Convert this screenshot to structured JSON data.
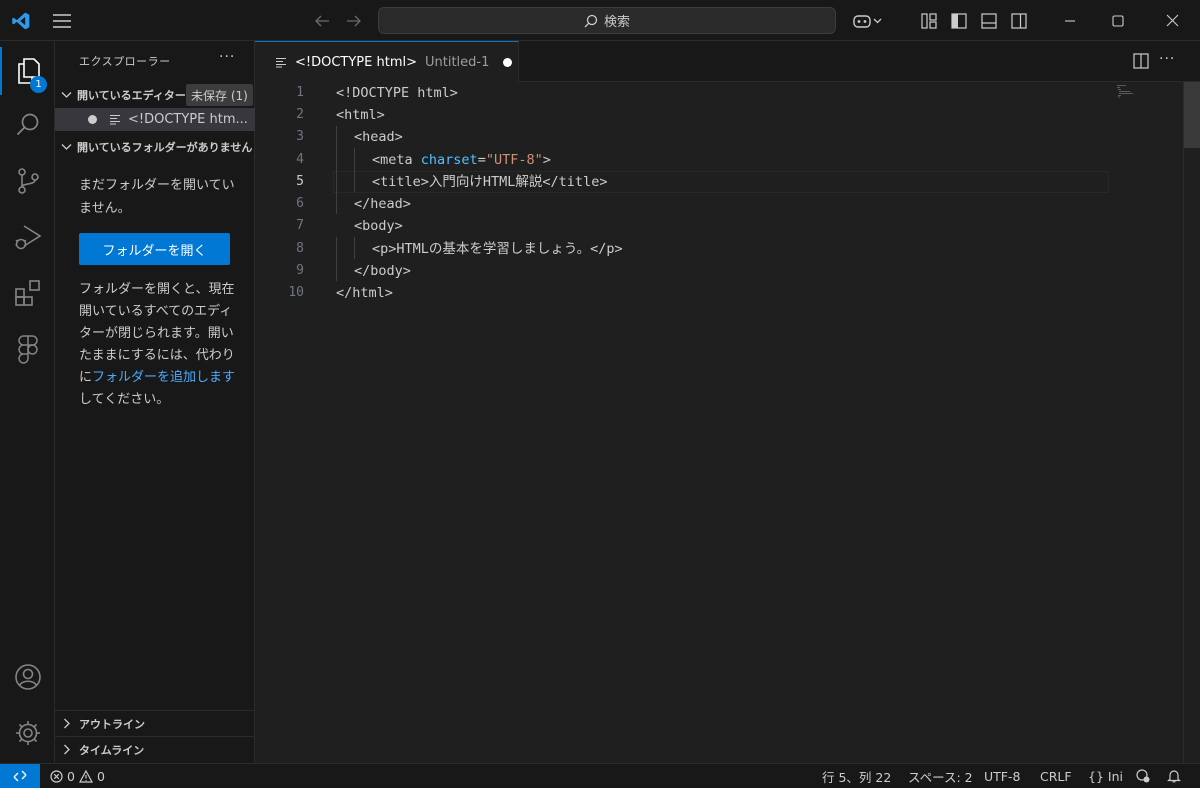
{
  "titlebar": {
    "search_label": "検索"
  },
  "activitybar": {
    "explorer_badge": "1"
  },
  "sidebar": {
    "title": "エクスプローラー",
    "more": "···",
    "open_editors_header": "開いているエディター",
    "unsaved_badge": "未保存 (1)",
    "open_editor_item": "<!DOCTYPE htm...",
    "no_folder_header": "開いているフォルダーがありません",
    "no_folder_text": "まだフォルダーを開いていません。",
    "open_folder_button": "フォルダーを開く",
    "help_text_before": "フォルダーを開くと、現在開いているすべてのエディターが閉じられます。開いたままにするには、代わりに",
    "add_folder_link": "フォルダーを追加します",
    "help_text_after": "してください。",
    "outline_header": "アウトライン",
    "timeline_header": "タイムライン"
  },
  "tab": {
    "title": "<!DOCTYPE html>",
    "description": "Untitled-1"
  },
  "editor": {
    "line_numbers": [
      "1",
      "2",
      "3",
      "4",
      "5",
      "6",
      "7",
      "8",
      "9",
      "10"
    ],
    "current_line": 5,
    "lines": {
      "l1": "<!DOCTYPE html>",
      "l2": "<html>",
      "l3": "<head>",
      "l4_a": "<meta ",
      "l4_attr": "charset",
      "l4_eq": "=",
      "l4_str": "\"UTF-8\"",
      "l4_b": ">",
      "l5_open": "<title>",
      "l5_text": "入門向けHTML解説",
      "l5_close": "</title>",
      "l6": "</head>",
      "l7": "<body>",
      "l8_open": "<p>",
      "l8_text": "HTMLの基本を学習しましょう。",
      "l8_close": "</p>",
      "l9": "</body>",
      "l10": "</html>"
    }
  },
  "statusbar": {
    "errors": "0",
    "warnings": "0",
    "position": "行 5、列 22",
    "indent": "スペース: 2",
    "encoding": "UTF-8",
    "eol": "CRLF",
    "language": "Ini",
    "braces": "{}"
  },
  "colors": {
    "accent": "#0078d4",
    "attr": "#4fc1ff",
    "string": "#ce9178"
  }
}
